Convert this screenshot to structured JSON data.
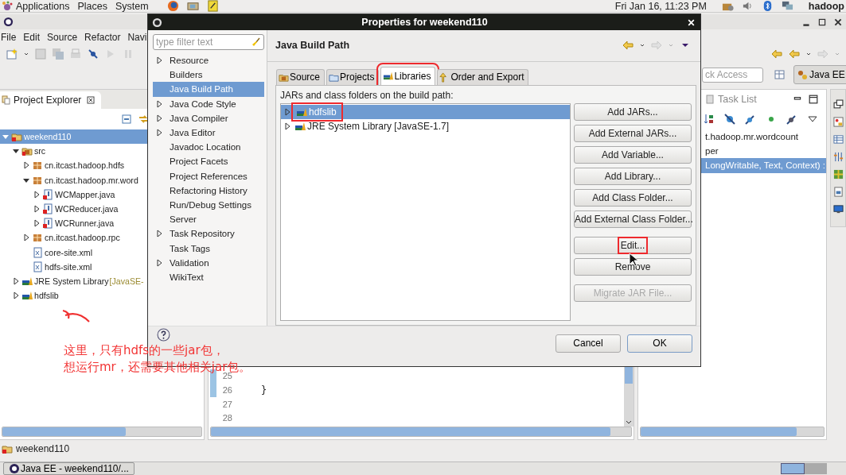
{
  "panel": {
    "menus": [
      "Applications",
      "Places",
      "System"
    ],
    "clock": "Fri Jan 16, 11:23 PM",
    "user": "hadoop"
  },
  "eclipse": {
    "menus": [
      "File",
      "Edit",
      "Source",
      "Refactor",
      "Navi"
    ],
    "quick_access": {
      "placeholder": "ck Access"
    },
    "perspective": "Java EE",
    "project_explorer": {
      "title": "Project Explorer",
      "tree": [
        {
          "label": "weekend110",
          "kind": "project",
          "expanded": true,
          "selected": true,
          "children": [
            {
              "label": "src",
              "kind": "folder",
              "expanded": true,
              "selected": false,
              "children": [
                {
                  "label": "cn.itcast.hadoop.hdfs",
                  "kind": "package",
                  "expanded": false,
                  "selected": false
                },
                {
                  "label": "cn.itcast.hadoop.mr.word",
                  "kind": "package",
                  "expanded": true,
                  "selected": false,
                  "children": [
                    {
                      "label": "WCMapper.java",
                      "kind": "java",
                      "expanded": false,
                      "selected": false
                    },
                    {
                      "label": "WCReducer.java",
                      "kind": "java",
                      "expanded": false,
                      "selected": false
                    },
                    {
                      "label": "WCRunner.java",
                      "kind": "java",
                      "expanded": false,
                      "selected": false
                    }
                  ]
                },
                {
                  "label": "cn.itcast.hadoop.rpc",
                  "kind": "package",
                  "expanded": false,
                  "selected": false
                },
                {
                  "label": "core-site.xml",
                  "kind": "xml",
                  "selected": false
                },
                {
                  "label": "hdfs-site.xml",
                  "kind": "xml",
                  "selected": false
                }
              ]
            },
            {
              "label": "JRE System Library",
              "decoration": "[JavaSE-",
              "kind": "library",
              "expanded": false,
              "selected": false
            },
            {
              "label": "hdfslib",
              "kind": "library",
              "expanded": false,
              "selected": false
            }
          ]
        }
      ]
    },
    "editor": {
      "lines": [
        {
          "number": "25"
        },
        {
          "number": "26",
          "code": "}"
        },
        {
          "number": "27"
        },
        {
          "number": "28"
        }
      ]
    },
    "task_panel": {
      "title": "Task List",
      "lines": [
        {
          "text": "t.hadoop.mr.wordcount",
          "selected": false
        },
        {
          "text": "per",
          "selected": false
        },
        {
          "text": "LongWritable, Text, Context) :",
          "selected": true
        }
      ]
    },
    "status": "weekend110"
  },
  "taskbar": {
    "window": "Java EE - weekend110/..."
  },
  "dialog": {
    "title": "Properties for weekend110",
    "filter": {
      "placeholder": "type filter text"
    },
    "pages": [
      {
        "label": "Resource",
        "expanded": false,
        "selected": false
      },
      {
        "label": "Builders",
        "selected": false
      },
      {
        "label": "Java Build Path",
        "selected": true
      },
      {
        "label": "Java Code Style",
        "expanded": false,
        "selected": false
      },
      {
        "label": "Java Compiler",
        "expanded": false,
        "selected": false
      },
      {
        "label": "Java Editor",
        "expanded": false,
        "selected": false
      },
      {
        "label": "Javadoc Location",
        "selected": false
      },
      {
        "label": "Project Facets",
        "selected": false
      },
      {
        "label": "Project References",
        "selected": false
      },
      {
        "label": "Refactoring History",
        "selected": false
      },
      {
        "label": "Run/Debug Settings",
        "selected": false
      },
      {
        "label": "Server",
        "selected": false
      },
      {
        "label": "Task Repository",
        "expanded": false,
        "selected": false
      },
      {
        "label": "Task Tags",
        "selected": false
      },
      {
        "label": "Validation",
        "expanded": false,
        "selected": false
      },
      {
        "label": "WikiText",
        "selected": false
      }
    ],
    "heading": "Java Build Path",
    "tabs": [
      {
        "label": "Source",
        "kind": "source",
        "selected": false,
        "highlighted": false
      },
      {
        "label": "Projects",
        "kind": "projects",
        "selected": false,
        "highlighted": false
      },
      {
        "label": "Libraries",
        "kind": "libraries",
        "selected": true,
        "highlighted": true
      },
      {
        "label": "Order and Export",
        "kind": "order",
        "selected": false,
        "highlighted": false
      }
    ],
    "list_label": "JARs and class folders on the build path:",
    "entries": [
      {
        "label": "hdfslib",
        "expanded": false,
        "selected": true,
        "highlighted": true
      },
      {
        "label": "JRE System Library [JavaSE-1.7]",
        "expanded": false,
        "selected": false,
        "highlighted": false
      }
    ],
    "button_groups": [
      [
        {
          "label": "Add JARs...",
          "disabled": false,
          "highlighted": false
        },
        {
          "label": "Add External JARs...",
          "disabled": false,
          "highlighted": false
        },
        {
          "label": "Add Variable...",
          "disabled": false,
          "highlighted": false
        },
        {
          "label": "Add Library...",
          "disabled": false,
          "highlighted": false
        },
        {
          "label": "Add Class Folder...",
          "disabled": false,
          "highlighted": false
        },
        {
          "label": "Add External Class Folder...",
          "disabled": false,
          "highlighted": false
        }
      ],
      [
        {
          "label": "Edit...",
          "disabled": false,
          "highlighted": true
        },
        {
          "label": "Remove",
          "disabled": false,
          "highlighted": false
        }
      ],
      [
        {
          "label": "Migrate JAR File...",
          "disabled": true,
          "highlighted": false
        }
      ]
    ],
    "cancel": "Cancel",
    "ok": "OK"
  },
  "annotation": {
    "lines": [
      "这里，只有hdfs的一些jar包，",
      "想运行mr，还需要其他相关jar包。"
    ]
  }
}
